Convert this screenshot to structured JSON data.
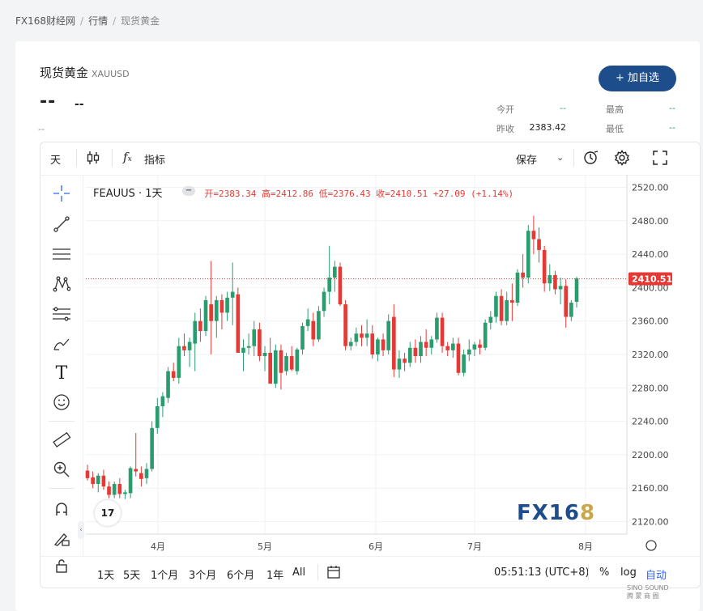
{
  "breadcrumb": {
    "home": "FX168财经网",
    "section": "行情",
    "current": "现货黄金"
  },
  "header": {
    "name": "现货黄金",
    "code": "XAUUSD",
    "price": "--",
    "change": "--",
    "sub": "--",
    "add_button": "+ 加自选",
    "stats": {
      "open_label": "今开",
      "open_value": "--",
      "prev_label": "昨收",
      "prev_value": "2383.42",
      "high_label": "最高",
      "high_value": "--",
      "low_label": "最低",
      "low_value": "--"
    }
  },
  "toolbar": {
    "interval": "天",
    "indicators": "指标",
    "save": "保存"
  },
  "legend": {
    "symbol": "FEAUUS · 1天",
    "values": "开=2383.34 高=2412.86 低=2376.43 收=2410.51 +27.09 (+1.14%)"
  },
  "bottombar": {
    "ranges": [
      "1天",
      "5天",
      "1个月",
      "3个月",
      "6个月",
      "1年",
      "All"
    ],
    "time": "05:51:13 (UTC+8)",
    "percent": "%",
    "log": "log",
    "auto": "自动"
  },
  "watermark": {
    "logo_text": "FX16",
    "logo_tail": "8"
  },
  "tv_logo": "17",
  "corner_stamp": {
    "line1": "SINO SOUND",
    "line2": "腾 蒙 商 圈"
  },
  "colors": {
    "up": "#2a9d6f",
    "down": "#e53935",
    "brand": "#1e4d8c",
    "last": "#e53935"
  },
  "chart_data": {
    "type": "candlestick",
    "symbol": "FEAUUS",
    "interval": "1天",
    "ylim": [
      2105,
      2535
    ],
    "yticks": [
      2120,
      2160,
      2200,
      2240,
      2280,
      2320,
      2360,
      2400,
      2440,
      2480,
      2520
    ],
    "xticks": [
      "4月",
      "5月",
      "6月",
      "7月",
      "8月"
    ],
    "last_price": 2410.51,
    "candles": [
      [
        2181,
        2188,
        2169,
        2172
      ],
      [
        2173,
        2180,
        2160,
        2165
      ],
      [
        2165,
        2178,
        2155,
        2175
      ],
      [
        2175,
        2182,
        2158,
        2162
      ],
      [
        2162,
        2168,
        2148,
        2152
      ],
      [
        2152,
        2168,
        2148,
        2165
      ],
      [
        2165,
        2172,
        2148,
        2153
      ],
      [
        2153,
        2158,
        2147,
        2155
      ],
      [
        2154,
        2186,
        2148,
        2184
      ],
      [
        2183,
        2226,
        2174,
        2180
      ],
      [
        2178,
        2186,
        2162,
        2171
      ],
      [
        2172,
        2190,
        2165,
        2183
      ],
      [
        2183,
        2240,
        2180,
        2232
      ],
      [
        2232,
        2268,
        2225,
        2258
      ],
      [
        2258,
        2275,
        2245,
        2270
      ],
      [
        2268,
        2305,
        2262,
        2300
      ],
      [
        2300,
        2310,
        2288,
        2292
      ],
      [
        2292,
        2340,
        2285,
        2330
      ],
      [
        2330,
        2345,
        2318,
        2325
      ],
      [
        2325,
        2340,
        2305,
        2335
      ],
      [
        2333,
        2370,
        2300,
        2360
      ],
      [
        2360,
        2375,
        2335,
        2348
      ],
      [
        2348,
        2390,
        2342,
        2385
      ],
      [
        2380,
        2432,
        2320,
        2360
      ],
      [
        2360,
        2390,
        2340,
        2385
      ],
      [
        2385,
        2392,
        2350,
        2370
      ],
      [
        2370,
        2395,
        2360,
        2388
      ],
      [
        2388,
        2430,
        2355,
        2395
      ],
      [
        2392,
        2400,
        2338,
        2322
      ],
      [
        2322,
        2338,
        2300,
        2328
      ],
      [
        2328,
        2345,
        2320,
        2330
      ],
      [
        2330,
        2360,
        2318,
        2350
      ],
      [
        2350,
        2358,
        2312,
        2318
      ],
      [
        2318,
        2330,
        2300,
        2322
      ],
      [
        2322,
        2340,
        2290,
        2285
      ],
      [
        2285,
        2332,
        2280,
        2325
      ],
      [
        2325,
        2332,
        2278,
        2298
      ],
      [
        2300,
        2322,
        2295,
        2318
      ],
      [
        2318,
        2330,
        2300,
        2302
      ],
      [
        2300,
        2328,
        2296,
        2326
      ],
      [
        2326,
        2358,
        2320,
        2354
      ],
      [
        2354,
        2375,
        2348,
        2362
      ],
      [
        2360,
        2370,
        2330,
        2338
      ],
      [
        2338,
        2378,
        2335,
        2372
      ],
      [
        2372,
        2400,
        2365,
        2395
      ],
      [
        2395,
        2450,
        2380,
        2412
      ],
      [
        2412,
        2432,
        2395,
        2425
      ],
      [
        2425,
        2430,
        2378,
        2380
      ],
      [
        2380,
        2385,
        2325,
        2330
      ],
      [
        2330,
        2340,
        2325,
        2335
      ],
      [
        2335,
        2352,
        2330,
        2345
      ],
      [
        2345,
        2355,
        2330,
        2340
      ],
      [
        2340,
        2362,
        2330,
        2345
      ],
      [
        2345,
        2355,
        2315,
        2320
      ],
      [
        2320,
        2340,
        2312,
        2338
      ],
      [
        2338,
        2345,
        2318,
        2325
      ],
      [
        2325,
        2368,
        2320,
        2360
      ],
      [
        2365,
        2380,
        2293,
        2302
      ],
      [
        2302,
        2325,
        2292,
        2315
      ],
      [
        2315,
        2322,
        2300,
        2310
      ],
      [
        2310,
        2335,
        2305,
        2328
      ],
      [
        2328,
        2338,
        2310,
        2318
      ],
      [
        2318,
        2342,
        2310,
        2335
      ],
      [
        2335,
        2350,
        2318,
        2328
      ],
      [
        2328,
        2342,
        2320,
        2338
      ],
      [
        2338,
        2370,
        2334,
        2364
      ],
      [
        2364,
        2370,
        2322,
        2330
      ],
      [
        2330,
        2335,
        2318,
        2325
      ],
      [
        2325,
        2340,
        2316,
        2333
      ],
      [
        2333,
        2340,
        2295,
        2298
      ],
      [
        2298,
        2326,
        2294,
        2320
      ],
      [
        2320,
        2338,
        2312,
        2326
      ],
      [
        2326,
        2335,
        2318,
        2332
      ],
      [
        2332,
        2338,
        2320,
        2328
      ],
      [
        2328,
        2362,
        2325,
        2358
      ],
      [
        2358,
        2372,
        2350,
        2365
      ],
      [
        2365,
        2395,
        2358,
        2390
      ],
      [
        2390,
        2398,
        2355,
        2360
      ],
      [
        2360,
        2395,
        2355,
        2385
      ],
      [
        2385,
        2405,
        2360,
        2382
      ],
      [
        2382,
        2422,
        2378,
        2418
      ],
      [
        2418,
        2440,
        2400,
        2412
      ],
      [
        2412,
        2475,
        2405,
        2468
      ],
      [
        2468,
        2486,
        2440,
        2458
      ],
      [
        2458,
        2472,
        2430,
        2445
      ],
      [
        2445,
        2450,
        2395,
        2405
      ],
      [
        2405,
        2428,
        2396,
        2415
      ],
      [
        2415,
        2420,
        2392,
        2398
      ],
      [
        2398,
        2412,
        2380,
        2402
      ],
      [
        2402,
        2410,
        2352,
        2365
      ],
      [
        2365,
        2385,
        2360,
        2382
      ],
      [
        2383,
        2413,
        2376,
        2411
      ]
    ]
  }
}
